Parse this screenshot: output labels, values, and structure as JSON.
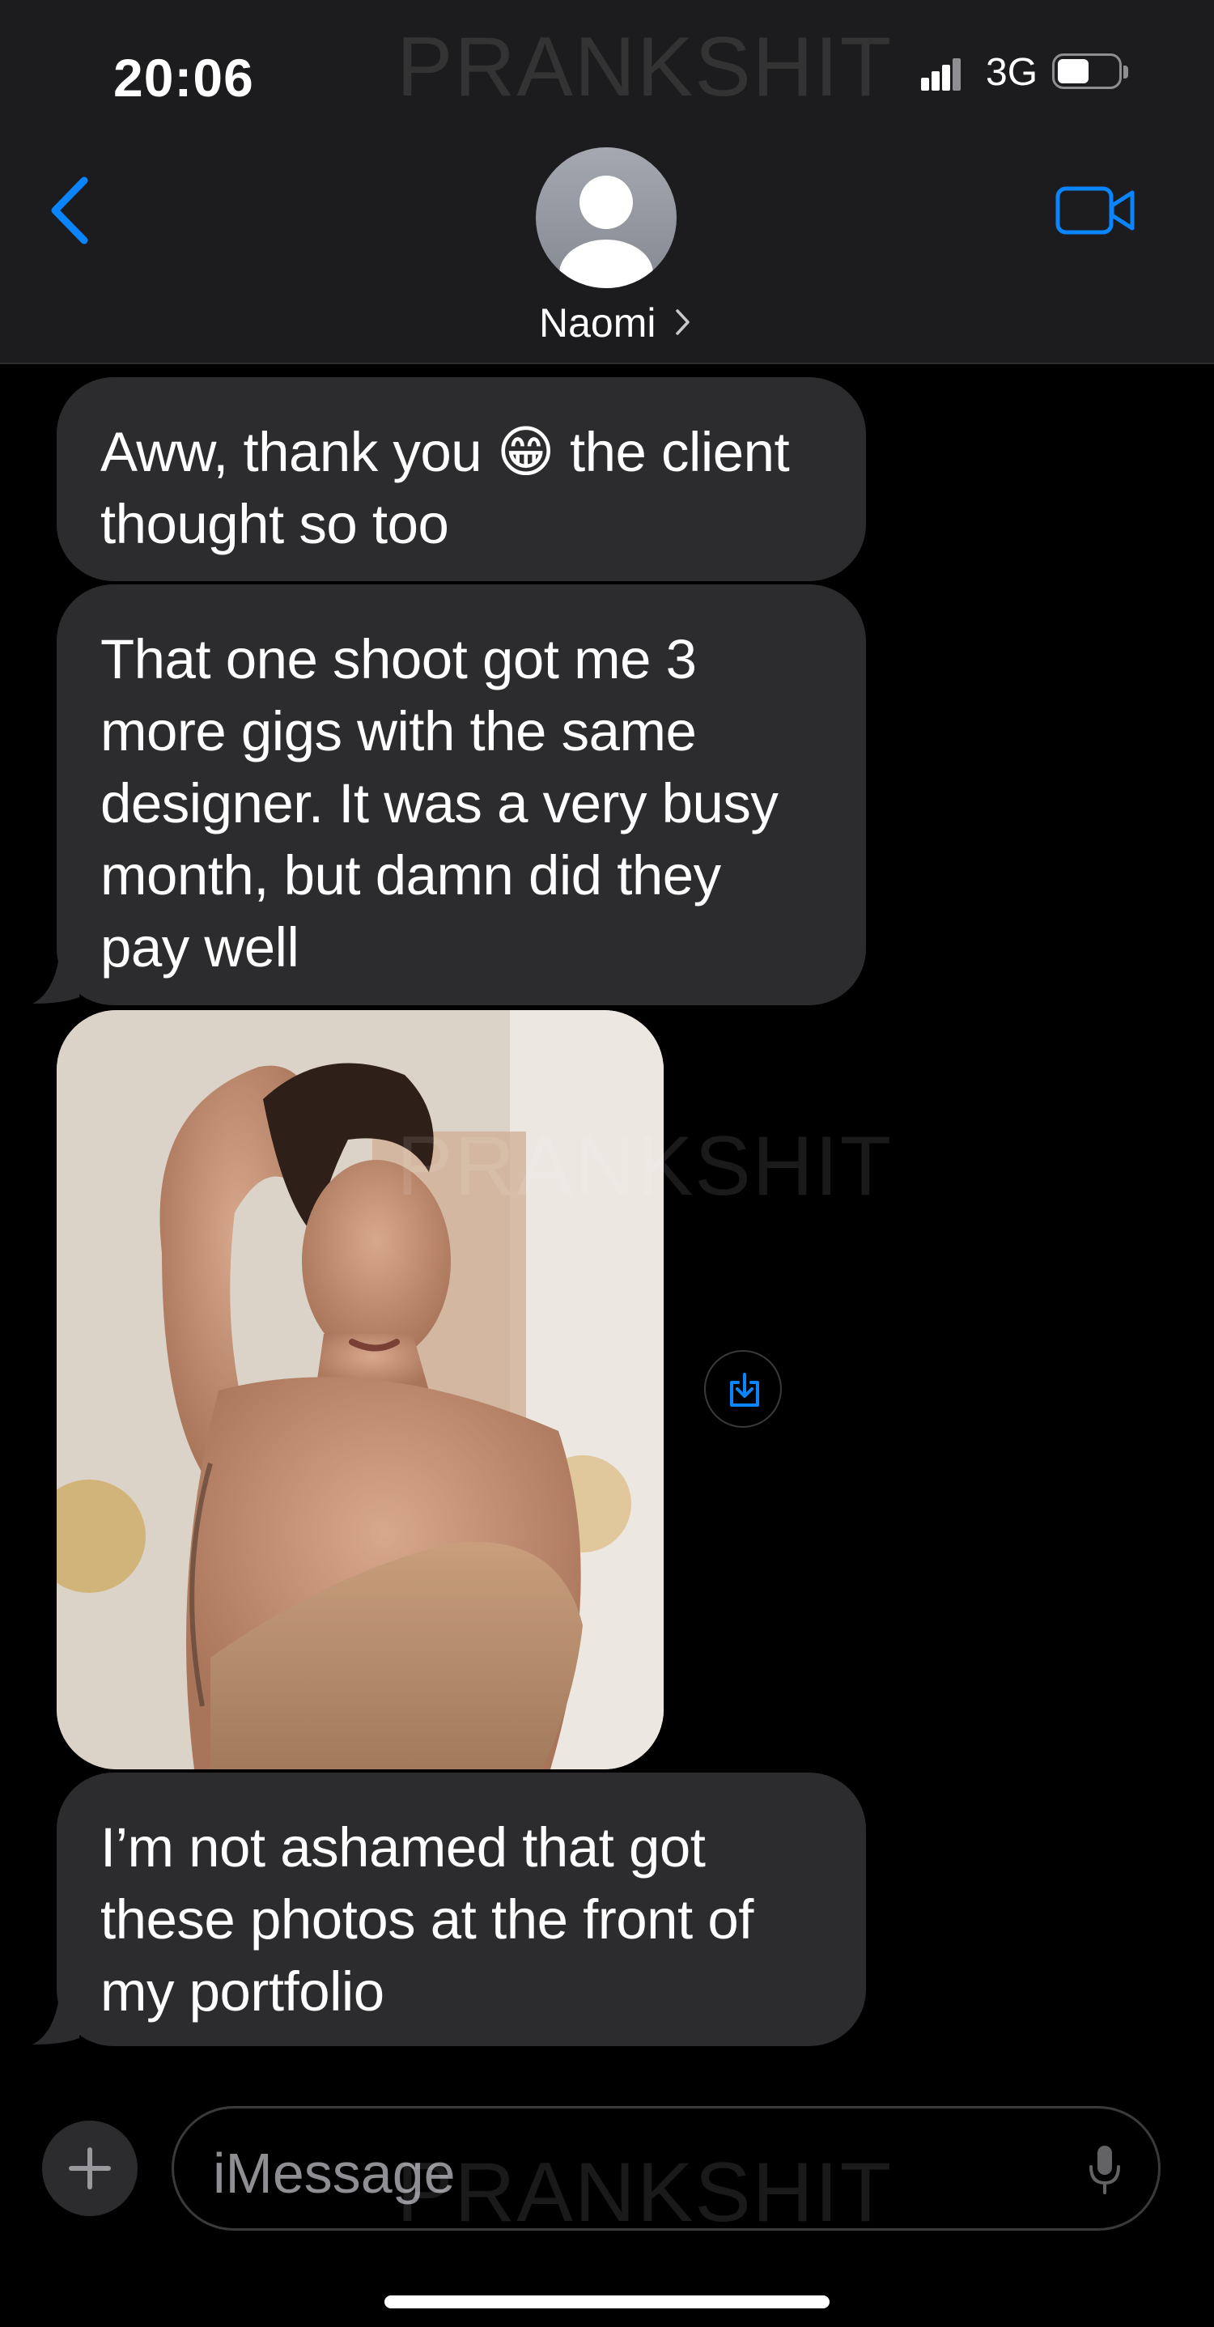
{
  "status_bar": {
    "time": "20:06",
    "network": "3G"
  },
  "watermark": "PRANKSHIT",
  "header": {
    "contact_name": "Naomi",
    "back_icon": "chevron-left-icon",
    "video_icon": "video-camera-icon"
  },
  "messages": [
    {
      "from": "contact",
      "type": "text",
      "text": "Aww, thank you 😁 the client thought so too"
    },
    {
      "from": "contact",
      "type": "text",
      "text": "That one shoot got me 3 more gigs with the same designer. It was a very busy month, but damn did they pay well"
    },
    {
      "from": "contact",
      "type": "image"
    },
    {
      "from": "contact",
      "type": "text",
      "text": "I’m not ashamed that got these photos at the front of my portfolio"
    }
  ],
  "compose": {
    "placeholder": "iMessage",
    "plus_icon": "plus-icon",
    "mic_icon": "microphone-icon"
  },
  "colors": {
    "accent": "#0a84ff",
    "bubble": "#2c2c2e",
    "header": "#1c1c1e",
    "background": "#000000"
  }
}
